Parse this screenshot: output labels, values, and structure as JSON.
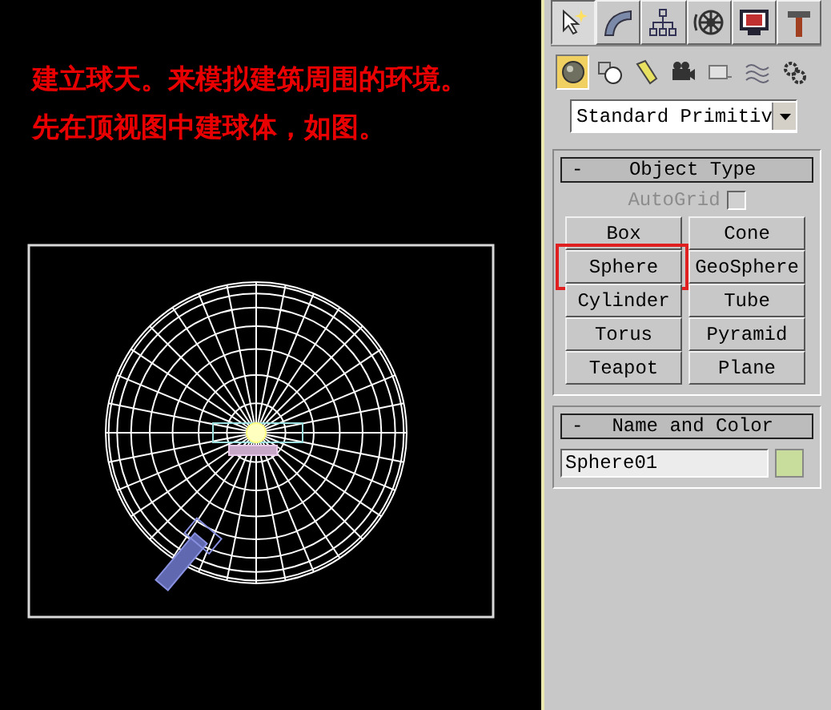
{
  "annotation": {
    "lines": [
      "建立球天。来模拟建筑周围的环境。",
      "先在顶视图中建球体，如图。"
    ]
  },
  "command_panel": {
    "tabs": [
      {
        "kind": "create",
        "selected": true
      },
      {
        "kind": "modify",
        "selected": false
      },
      {
        "kind": "hierarchy",
        "selected": false
      },
      {
        "kind": "motion",
        "selected": false
      },
      {
        "kind": "display",
        "selected": false
      },
      {
        "kind": "utilities",
        "selected": false
      }
    ],
    "categories": [
      {
        "kind": "geometry",
        "selected": true
      },
      {
        "kind": "shapes",
        "selected": false
      },
      {
        "kind": "lights",
        "selected": false
      },
      {
        "kind": "cameras",
        "selected": false
      },
      {
        "kind": "helpers",
        "selected": false
      },
      {
        "kind": "spacewarps",
        "selected": false
      },
      {
        "kind": "systems",
        "selected": false
      }
    ],
    "dropdown": {
      "value": "Standard Primitiv"
    },
    "object_type": {
      "collapse": "-",
      "title": "Object Type",
      "autogrid": {
        "label": "AutoGrid",
        "checked": false,
        "disabled": true
      },
      "buttons": [
        {
          "label": "Box",
          "highlighted": false
        },
        {
          "label": "Cone",
          "highlighted": false
        },
        {
          "label": "Sphere",
          "highlighted": true
        },
        {
          "label": "GeoSphere",
          "highlighted": false
        },
        {
          "label": "Cylinder",
          "highlighted": false
        },
        {
          "label": "Tube",
          "highlighted": false
        },
        {
          "label": "Torus",
          "highlighted": false
        },
        {
          "label": "Pyramid",
          "highlighted": false
        },
        {
          "label": "Teapot",
          "highlighted": false
        },
        {
          "label": "Plane",
          "highlighted": false
        }
      ]
    },
    "name_and_color": {
      "collapse": "-",
      "title": "Name and Color",
      "name": "Sphere01",
      "color": "#c8dc9c"
    }
  }
}
